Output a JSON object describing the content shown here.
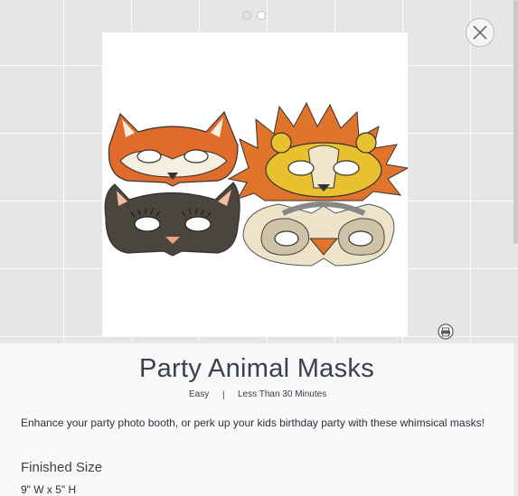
{
  "project": {
    "title": "Party Animal Masks",
    "difficulty": "Easy",
    "separator": "|",
    "duration": "Less Than 30 Minutes",
    "description": "Enhance your party photo booth, or perk up your kids birthday party with these whimsical masks!",
    "finished_size_heading": "Finished Size",
    "finished_size_value": "9\" W x 5\" H"
  },
  "carousel": {
    "count": 2,
    "active": 1
  },
  "icons": {
    "close": "close-icon",
    "print": "printer-icon"
  },
  "colors": {
    "fox": "#e06b2a",
    "fox_light": "#f6efdf",
    "cat": "#4a463e",
    "lion_mane": "#e0742a",
    "lion_face": "#e9c12f",
    "owl": "#ede3c9"
  }
}
